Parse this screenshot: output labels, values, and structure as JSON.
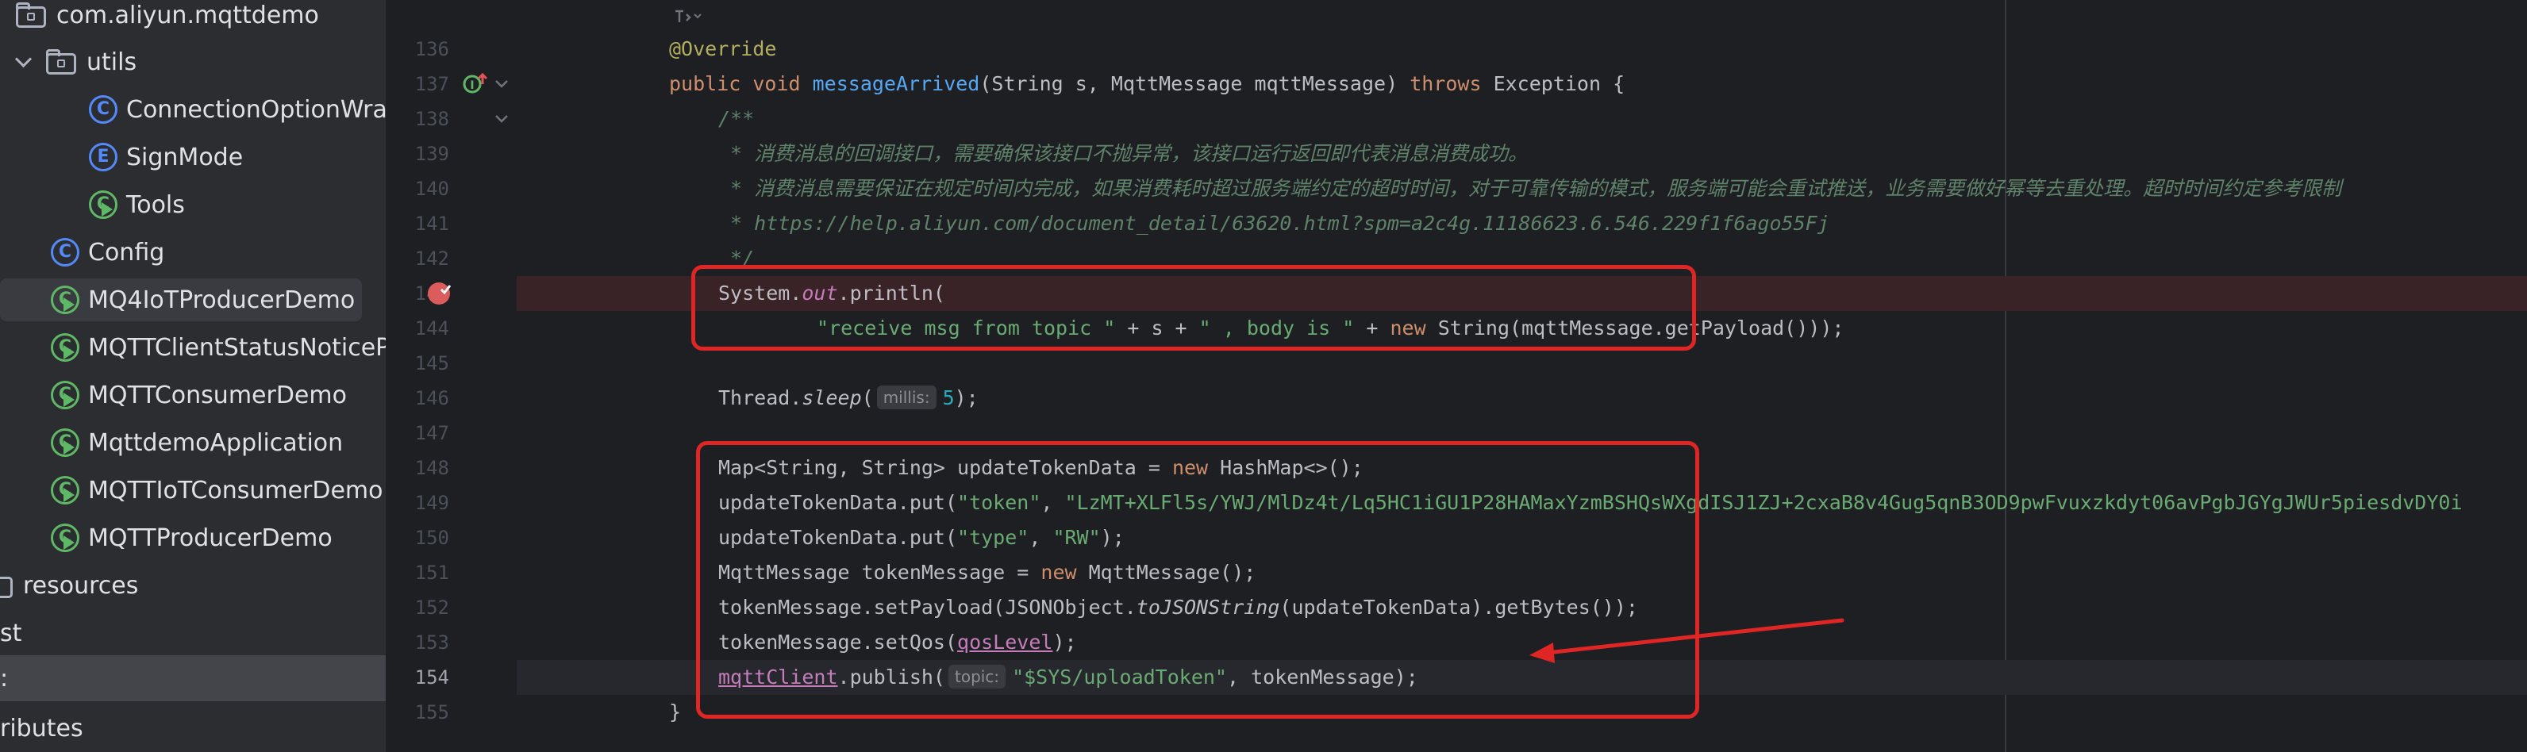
{
  "tree": {
    "items": [
      {
        "label": "com.aliyun.mqttdemo",
        "icon": "package-icon"
      },
      {
        "label": "utils",
        "icon": "package-icon"
      },
      {
        "label": "ConnectionOptionWrapper",
        "icon": "class-icon",
        "glyph": "C"
      },
      {
        "label": "SignMode",
        "icon": "enum-icon",
        "glyph": "E"
      },
      {
        "label": "Tools",
        "icon": "runnable-class-icon",
        "glyph": "C"
      },
      {
        "label": "Config",
        "icon": "class-icon",
        "glyph": "C"
      },
      {
        "label": "MQ4IoTProducerDemo",
        "icon": "runnable-class-icon",
        "glyph": "C"
      },
      {
        "label": "MQTTClientStatusNoticeProcessDemo",
        "icon": "runnable-class-icon",
        "glyph": "C"
      },
      {
        "label": "MQTTConsumerDemo",
        "icon": "runnable-class-icon",
        "glyph": "C"
      },
      {
        "label": "MqttdemoApplication",
        "icon": "runnable-class-icon",
        "glyph": "C"
      },
      {
        "label": "MQTTIoTConsumerDemo",
        "icon": "runnable-class-icon",
        "glyph": "C"
      },
      {
        "label": "MQTTProducerDemo",
        "icon": "runnable-class-icon",
        "glyph": "C"
      },
      {
        "label": "resources",
        "icon": "folder-icon"
      },
      {
        "label": "st"
      },
      {
        "label": ":"
      },
      {
        "label": "ributes"
      }
    ]
  },
  "gutter": {
    "line_numbers": [
      "136",
      "137",
      "138",
      "139",
      "140",
      "141",
      "142",
      "143",
      "144",
      "145",
      "146",
      "147",
      "148",
      "149",
      "150",
      "151",
      "152",
      "153",
      "154",
      "155"
    ]
  },
  "editor": {
    "override": "@Override",
    "sig_public": "public ",
    "sig_void": "void ",
    "sig_name": "messageArrived",
    "sig_params": "(String s, MqttMessage mqttMessage) ",
    "sig_throws": "throws",
    "sig_tail": " Exception {",
    "doc_open": "/**",
    "doc_1": " * 消费消息的回调接口，需要确保该接口不抛异常，该接口运行返回即代表消息消费成功。",
    "doc_2": " * 消费消息需要保证在规定时间内完成，如果消费耗时超过服务端约定的超时时间，对于可靠传输的模式，服务端可能会重试推送，业务需要做好幂等去重处理。超时时间约定参考限制",
    "doc_3": " * https://help.aliyun.com/document_detail/63620.html?spm=a2c4g.11186623.6.546.229f1f6ago55Fj",
    "doc_close": " */",
    "l143_a": "System.",
    "l143_out": "out",
    "l143_b": ".println(",
    "l144_str": "\"receive msg from topic \"",
    "l144_a": " + s + ",
    "l144_str2": "\" , body is \"",
    "l144_b": " + ",
    "l144_new": "new",
    "l144_c": " String(mqttMessage.getPayload()));",
    "l146_a": "Thread.",
    "l146_sleep": "sleep",
    "l146_b": "(",
    "l146_hint": "millis:",
    "l146_num": "5",
    "l146_c": ");",
    "l148_a": "Map<String, String> updateTokenData = ",
    "l148_new": "new",
    "l148_b": " HashMap<>();",
    "l149_a": "updateTokenData.put(",
    "l149_str": "\"token\"",
    "l149_b": ", ",
    "l149_val": "\"LzMT+XLFl5s/YWJ/MlDz4t/Lq5HC1iGU1P28HAMaxYzmBSHQsWXgdISJ1ZJ+2cxaB8v4Gug5qnB3OD9pwFvuxzkdyt06avPgbJGYgJWUr5piesdvDY0i",
    "l150_a": "updateTokenData.put(",
    "l150_str": "\"type\"",
    "l150_b": ", ",
    "l150_str2": "\"RW\"",
    "l150_c": ");",
    "l151_a": "MqttMessage tokenMessage = ",
    "l151_new": "new",
    "l151_b": " MqttMessage();",
    "l152_a": "tokenMessage.setPayload(JSONObject.",
    "l152_fn": "toJSONString",
    "l152_b": "(updateTokenData).getBytes());",
    "l153_a": "tokenMessage.setQos(",
    "l153_fld": "qosLevel",
    "l153_b": ");",
    "l154_fld": "mqttClient",
    "l154_a": ".publish(",
    "l154_hint": "topic:",
    "l154_str": "\"$SYS/uploadToken\"",
    "l154_b": ", tokenMessage);",
    "l155": "}"
  },
  "colors": {
    "annotation_red": "#e02525",
    "keyword": "#cf8e6d",
    "string": "#6aab73",
    "method": "#56a8f5",
    "comment": "#5f826b"
  }
}
